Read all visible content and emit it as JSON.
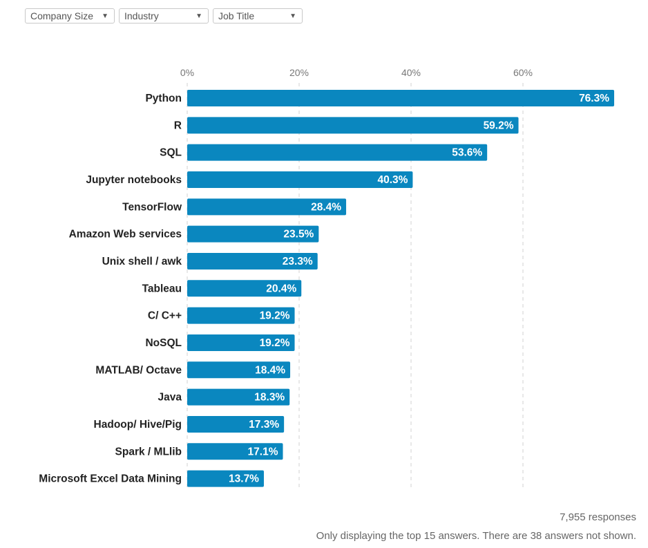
{
  "filters": [
    {
      "label": "Company Size"
    },
    {
      "label": "Industry"
    },
    {
      "label": "Job Title"
    }
  ],
  "colors": {
    "bar": "#0a87bf",
    "grid": "#d0d0d0",
    "label": "#222222",
    "axis_text": "#777777"
  },
  "chart_data": {
    "type": "bar",
    "orientation": "horizontal",
    "categories": [
      "Python",
      "R",
      "SQL",
      "Jupyter notebooks",
      "TensorFlow",
      "Amazon Web services",
      "Unix shell / awk",
      "Tableau",
      "C/ C++",
      "NoSQL",
      "MATLAB/ Octave",
      "Java",
      "Hadoop/ Hive/Pig",
      "Spark / MLlib",
      "Microsoft Excel Data Mining"
    ],
    "values": [
      76.3,
      59.2,
      53.6,
      40.3,
      28.4,
      23.5,
      23.3,
      20.4,
      19.2,
      19.2,
      18.4,
      18.3,
      17.3,
      17.1,
      13.7
    ],
    "value_labels": [
      "76.3%",
      "59.2%",
      "53.6%",
      "40.3%",
      "28.4%",
      "23.5%",
      "23.3%",
      "20.4%",
      "19.2%",
      "19.2%",
      "18.4%",
      "18.3%",
      "17.3%",
      "17.1%",
      "13.7%"
    ],
    "xticks": [
      0,
      20,
      40,
      60
    ],
    "xtick_labels": [
      "0%",
      "20%",
      "40%",
      "60%"
    ],
    "xlim": [
      0,
      80
    ],
    "grid": true
  },
  "footer": {
    "responses": "7,955 responses",
    "note": "Only displaying the top 15 answers. There are 38 answers not shown."
  }
}
